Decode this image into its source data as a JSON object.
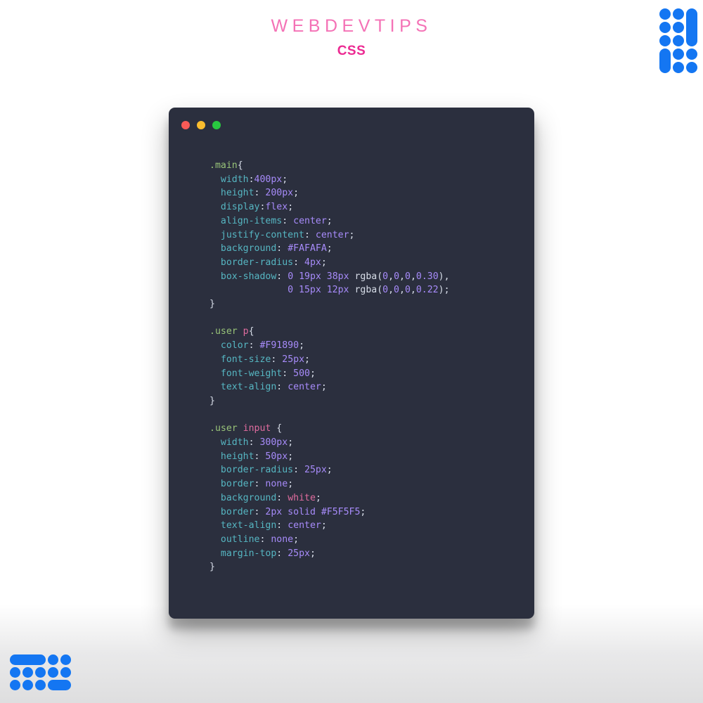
{
  "header": {
    "title": "WEBDEVTIPS",
    "subtitle": "CSS"
  },
  "colors": {
    "page_background": "#FFFFFF",
    "title": "#F472B6",
    "subtitle": "#EC2A92",
    "window_background": "#2B2F3E",
    "logo_blue": "#1476F2",
    "traffic_red": "#F85A57",
    "traffic_yellow": "#FBBD2E",
    "traffic_green": "#28C840",
    "token_selector": "#98C379",
    "token_element": "#E06C9F",
    "token_property": "#56B6C2",
    "token_value": "#A78BFA",
    "token_punctuation": "#D8DEE9"
  },
  "window": {
    "traffic_lights": [
      {
        "name": "close",
        "color": "#F85A57"
      },
      {
        "name": "minimize",
        "color": "#FBBD2E"
      },
      {
        "name": "maximize",
        "color": "#28C840"
      }
    ]
  },
  "code": {
    "language": "CSS",
    "plain_text": ".main{\n  width:400px;\n  height: 200px;\n  display:flex;\n  align-items: center;\n  justify-content: center;\n  background: #FAFAFA;\n  border-radius: 4px;\n  box-shadow: 0 19px 38px rgba(0,0,0,0.30),\n              0 15px 12px rgba(0,0,0,0.22);\n}\n\n.user p{\n  color: #F91890;\n  font-size: 25px;\n  font-weight: 500;\n  text-align: center;\n}\n\n.user input {\n  width: 300px;\n  height: 50px;\n  border-radius: 25px;\n  border: none;\n  background: white;\n  border: 2px solid #F5F5F5;\n  text-align: center;\n  outline: none;\n  margin-top: 25px;\n}",
    "lines": [
      {
        "indent": 0,
        "tokens": [
          {
            "t": "sel",
            "v": ".main"
          },
          {
            "t": "punc",
            "v": "{"
          }
        ]
      },
      {
        "indent": 1,
        "tokens": [
          {
            "t": "prop",
            "v": "width"
          },
          {
            "t": "punc",
            "v": ":"
          },
          {
            "t": "val",
            "v": "400px"
          },
          {
            "t": "punc",
            "v": ";"
          }
        ]
      },
      {
        "indent": 1,
        "tokens": [
          {
            "t": "prop",
            "v": "height"
          },
          {
            "t": "punc",
            "v": ": "
          },
          {
            "t": "val",
            "v": "200px"
          },
          {
            "t": "punc",
            "v": ";"
          }
        ]
      },
      {
        "indent": 1,
        "tokens": [
          {
            "t": "prop",
            "v": "display"
          },
          {
            "t": "punc",
            "v": ":"
          },
          {
            "t": "val",
            "v": "flex"
          },
          {
            "t": "punc",
            "v": ";"
          }
        ]
      },
      {
        "indent": 1,
        "tokens": [
          {
            "t": "prop",
            "v": "align-items"
          },
          {
            "t": "punc",
            "v": ": "
          },
          {
            "t": "val",
            "v": "center"
          },
          {
            "t": "punc",
            "v": ";"
          }
        ]
      },
      {
        "indent": 1,
        "tokens": [
          {
            "t": "prop",
            "v": "justify-content"
          },
          {
            "t": "punc",
            "v": ": "
          },
          {
            "t": "val",
            "v": "center"
          },
          {
            "t": "punc",
            "v": ";"
          }
        ]
      },
      {
        "indent": 1,
        "tokens": [
          {
            "t": "prop",
            "v": "background"
          },
          {
            "t": "punc",
            "v": ": "
          },
          {
            "t": "val",
            "v": "#FAFAFA"
          },
          {
            "t": "punc",
            "v": ";"
          }
        ]
      },
      {
        "indent": 1,
        "tokens": [
          {
            "t": "prop",
            "v": "border-radius"
          },
          {
            "t": "punc",
            "v": ": "
          },
          {
            "t": "val",
            "v": "4px"
          },
          {
            "t": "punc",
            "v": ";"
          }
        ]
      },
      {
        "indent": 1,
        "tokens": [
          {
            "t": "prop",
            "v": "box-shadow"
          },
          {
            "t": "punc",
            "v": ": "
          },
          {
            "t": "val",
            "v": "0 19px 38px "
          },
          {
            "t": "punc",
            "v": "rgba("
          },
          {
            "t": "val",
            "v": "0"
          },
          {
            "t": "punc",
            "v": ","
          },
          {
            "t": "val",
            "v": "0"
          },
          {
            "t": "punc",
            "v": ","
          },
          {
            "t": "val",
            "v": "0"
          },
          {
            "t": "punc",
            "v": ","
          },
          {
            "t": "val",
            "v": "0.30"
          },
          {
            "t": "punc",
            "v": "),"
          }
        ]
      },
      {
        "indent": 7,
        "tokens": [
          {
            "t": "val",
            "v": "0 15px 12px "
          },
          {
            "t": "punc",
            "v": "rgba("
          },
          {
            "t": "val",
            "v": "0"
          },
          {
            "t": "punc",
            "v": ","
          },
          {
            "t": "val",
            "v": "0"
          },
          {
            "t": "punc",
            "v": ","
          },
          {
            "t": "val",
            "v": "0"
          },
          {
            "t": "punc",
            "v": ","
          },
          {
            "t": "val",
            "v": "0.22"
          },
          {
            "t": "punc",
            "v": ");"
          }
        ]
      },
      {
        "indent": 0,
        "tokens": [
          {
            "t": "punc",
            "v": "}"
          }
        ]
      },
      {
        "blank": true
      },
      {
        "indent": 0,
        "tokens": [
          {
            "t": "sel",
            "v": ".user "
          },
          {
            "t": "el",
            "v": "p"
          },
          {
            "t": "punc",
            "v": "{"
          }
        ]
      },
      {
        "indent": 1,
        "tokens": [
          {
            "t": "prop",
            "v": "color"
          },
          {
            "t": "punc",
            "v": ": "
          },
          {
            "t": "val",
            "v": "#F91890"
          },
          {
            "t": "punc",
            "v": ";"
          }
        ]
      },
      {
        "indent": 1,
        "tokens": [
          {
            "t": "prop",
            "v": "font-size"
          },
          {
            "t": "punc",
            "v": ": "
          },
          {
            "t": "val",
            "v": "25px"
          },
          {
            "t": "punc",
            "v": ";"
          }
        ]
      },
      {
        "indent": 1,
        "tokens": [
          {
            "t": "prop",
            "v": "font-weight"
          },
          {
            "t": "punc",
            "v": ": "
          },
          {
            "t": "val",
            "v": "500"
          },
          {
            "t": "punc",
            "v": ";"
          }
        ]
      },
      {
        "indent": 1,
        "tokens": [
          {
            "t": "prop",
            "v": "text-align"
          },
          {
            "t": "punc",
            "v": ": "
          },
          {
            "t": "val",
            "v": "center"
          },
          {
            "t": "punc",
            "v": ";"
          }
        ]
      },
      {
        "indent": 0,
        "tokens": [
          {
            "t": "punc",
            "v": "}"
          }
        ]
      },
      {
        "blank": true
      },
      {
        "indent": 0,
        "tokens": [
          {
            "t": "sel",
            "v": ".user "
          },
          {
            "t": "el",
            "v": "input"
          },
          {
            "t": "punc",
            "v": " {"
          }
        ]
      },
      {
        "indent": 1,
        "tokens": [
          {
            "t": "prop",
            "v": "width"
          },
          {
            "t": "punc",
            "v": ": "
          },
          {
            "t": "val",
            "v": "300px"
          },
          {
            "t": "punc",
            "v": ";"
          }
        ]
      },
      {
        "indent": 1,
        "tokens": [
          {
            "t": "prop",
            "v": "height"
          },
          {
            "t": "punc",
            "v": ": "
          },
          {
            "t": "val",
            "v": "50px"
          },
          {
            "t": "punc",
            "v": ";"
          }
        ]
      },
      {
        "indent": 1,
        "tokens": [
          {
            "t": "prop",
            "v": "border-radius"
          },
          {
            "t": "punc",
            "v": ": "
          },
          {
            "t": "val",
            "v": "25px"
          },
          {
            "t": "punc",
            "v": ";"
          }
        ]
      },
      {
        "indent": 1,
        "tokens": [
          {
            "t": "prop",
            "v": "border"
          },
          {
            "t": "punc",
            "v": ": "
          },
          {
            "t": "val",
            "v": "none"
          },
          {
            "t": "punc",
            "v": ";"
          }
        ]
      },
      {
        "indent": 1,
        "tokens": [
          {
            "t": "prop",
            "v": "background"
          },
          {
            "t": "punc",
            "v": ": "
          },
          {
            "t": "key",
            "v": "white"
          },
          {
            "t": "punc",
            "v": ";"
          }
        ]
      },
      {
        "indent": 1,
        "tokens": [
          {
            "t": "prop",
            "v": "border"
          },
          {
            "t": "punc",
            "v": ": "
          },
          {
            "t": "val",
            "v": "2px solid #F5F5F5"
          },
          {
            "t": "punc",
            "v": ";"
          }
        ]
      },
      {
        "indent": 1,
        "tokens": [
          {
            "t": "prop",
            "v": "text-align"
          },
          {
            "t": "punc",
            "v": ": "
          },
          {
            "t": "val",
            "v": "center"
          },
          {
            "t": "punc",
            "v": ";"
          }
        ]
      },
      {
        "indent": 1,
        "tokens": [
          {
            "t": "prop",
            "v": "outline"
          },
          {
            "t": "punc",
            "v": ": "
          },
          {
            "t": "val",
            "v": "none"
          },
          {
            "t": "punc",
            "v": ";"
          }
        ]
      },
      {
        "indent": 1,
        "tokens": [
          {
            "t": "prop",
            "v": "margin-top"
          },
          {
            "t": "punc",
            "v": ": "
          },
          {
            "t": "val",
            "v": "25px"
          },
          {
            "t": "punc",
            "v": ";"
          }
        ]
      },
      {
        "indent": 0,
        "tokens": [
          {
            "t": "punc",
            "v": "}"
          }
        ]
      }
    ]
  },
  "logo_top_right": {
    "name": "dot-matrix-logo",
    "columns": 3,
    "rows": 5,
    "cells": [
      "on",
      "on",
      "v-pill-top",
      "on",
      "on",
      "v-pill-mid",
      "on",
      "on",
      "v-pill-bot",
      "v-pill-top2",
      "on",
      "on",
      "v-pill-bot2",
      "on",
      "on"
    ]
  },
  "logo_bottom_left": {
    "name": "dot-matrix-logo",
    "columns": 5,
    "rows": 3,
    "cells": [
      "h-pill-a",
      "h-pill-b",
      "h-pill-c",
      "on",
      "on",
      "on",
      "on",
      "on",
      "on",
      "on",
      "on",
      "on",
      "on",
      "h-pill-d",
      "h-pill-e"
    ]
  }
}
